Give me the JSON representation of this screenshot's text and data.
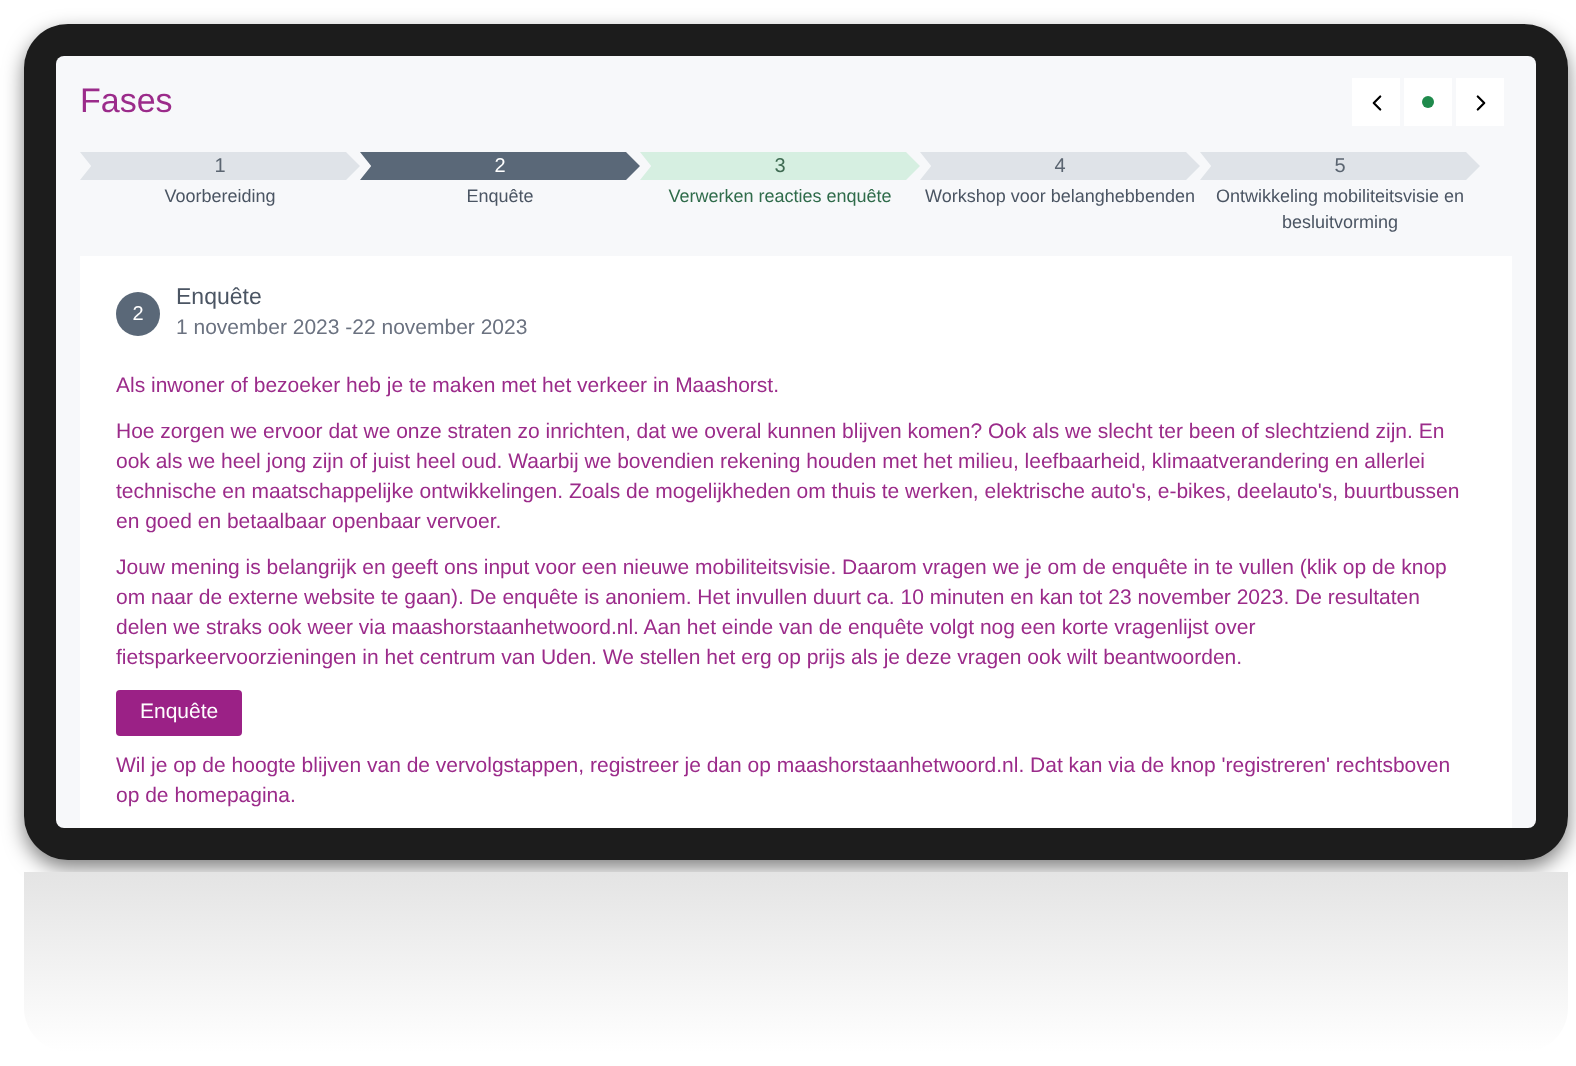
{
  "title": "Fases",
  "steps": [
    {
      "number": "1",
      "label": "Voorbereiding",
      "kind": "plain",
      "selected": false
    },
    {
      "number": "2",
      "label": "Enquête",
      "kind": "plain",
      "selected": true
    },
    {
      "number": "3",
      "label": "Verwerken reacties enquête",
      "kind": "highlighted",
      "selected": false
    },
    {
      "number": "4",
      "label": "Workshop voor belanghebbenden",
      "kind": "plain",
      "selected": false
    },
    {
      "number": "5",
      "label": "Ontwikkeling mobiliteitsvisie en besluitvorming",
      "kind": "plain",
      "selected": false
    }
  ],
  "phase": {
    "number": "2",
    "title": "Enquête",
    "dates": "1 november 2023 -22 november 2023"
  },
  "paragraphs_before": [
    "Als inwoner of bezoeker heb je te maken met het verkeer in Maashorst.",
    "Hoe zorgen we ervoor dat we onze straten zo inrichten, dat we overal kunnen blijven komen? Ook als we slecht ter been of slechtziend zijn. En ook als we heel jong zijn of juist heel oud. Waarbij we bovendien rekening houden met het milieu, leefbaarheid, klimaatverandering en allerlei technische en maatschappelijke ontwikkelingen. Zoals de mogelijkheden om thuis te werken, elektrische auto's, e-bikes, deelauto's, buurtbussen en goed en betaalbaar openbaar vervoer.",
    "Jouw mening is belangrijk en geeft ons input voor een nieuwe mobiliteitsvisie. Daarom vragen we je om de enquête in te vullen (klik op de knop om naar de externe website te gaan). De enquête is anoniem. Het invullen duurt ca. 10 minuten en kan tot 23 november 2023. De resultaten delen we straks ook weer via maashorstaanhetwoord.nl. Aan het einde van de enquête volgt nog een korte vragenlijst over fietsparkeervoorzieningen in het centrum van Uden. We stellen het erg op prijs als je deze vragen ook wilt beantwoorden."
  ],
  "button": "Enquête",
  "paragraphs_after": [
    "Wil je op de hoogte blijven van de vervolgstappen, registreer je dan op maashorstaanhetwoord.nl. Dat kan via de knop 'registreren' rechtsboven op de homepagina."
  ]
}
